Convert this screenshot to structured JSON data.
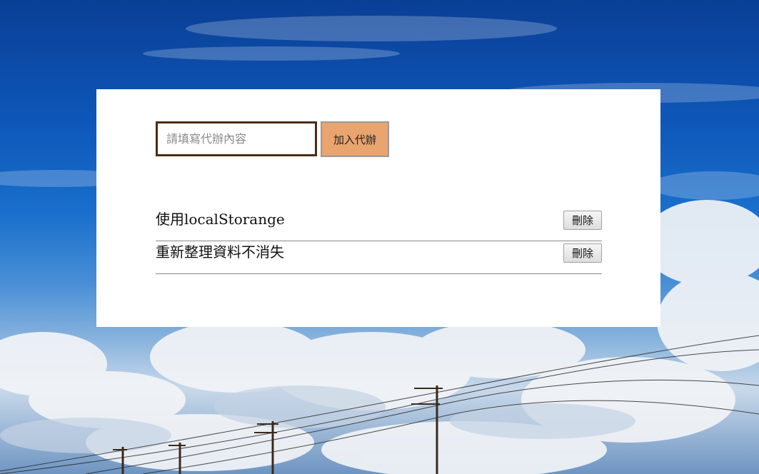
{
  "form": {
    "input_placeholder": "請填寫代辦內容",
    "input_value": "",
    "add_button_label": "加入代辦"
  },
  "todos": [
    {
      "text": "使用localStorange",
      "delete_label": "刪除"
    },
    {
      "text": "重新整理資料不消失",
      "delete_label": "刪除"
    }
  ],
  "colors": {
    "add_button_bg": "#e9a46f",
    "input_border": "#4a2c12",
    "card_bg": "#ffffff"
  }
}
